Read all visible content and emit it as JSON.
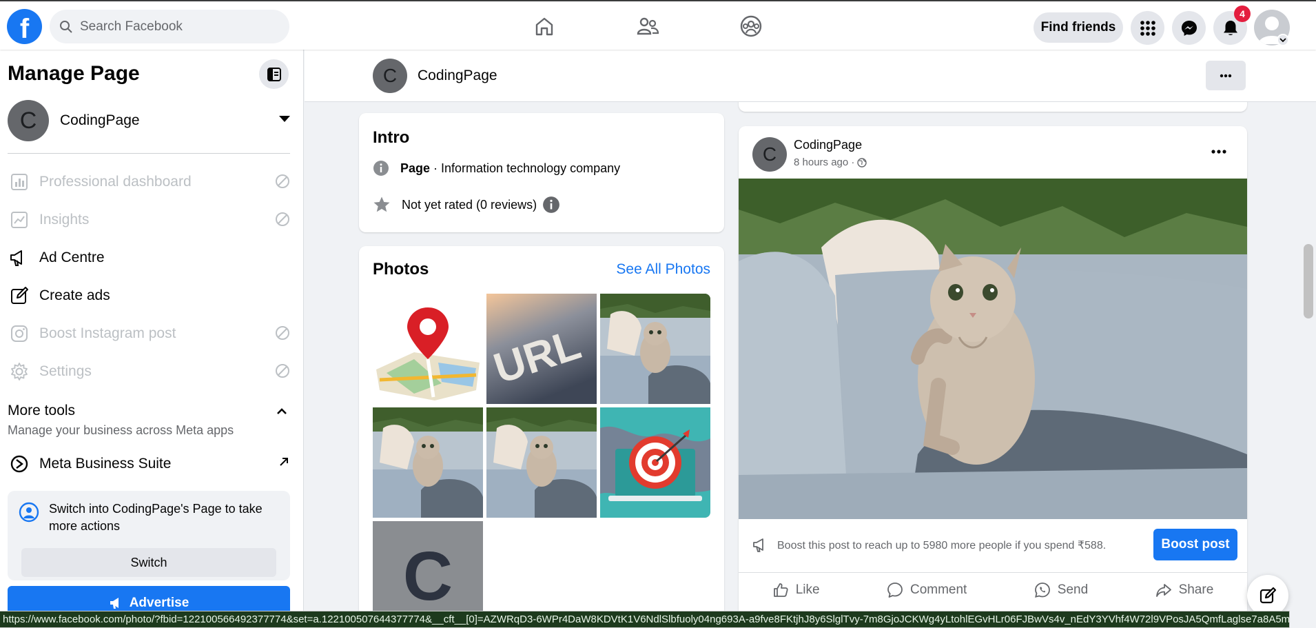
{
  "topbar": {
    "search_placeholder": "Search Facebook",
    "find_friends": "Find friends",
    "notification_count": "4",
    "logo_letter": "f"
  },
  "sidebar": {
    "title": "Manage Page",
    "page_name": "CodingPage",
    "page_initial": "C",
    "items": [
      {
        "label": "Professional dashboard",
        "icon": "dashboard-icon",
        "disabled": true
      },
      {
        "label": "Insights",
        "icon": "insights-icon",
        "disabled": true
      },
      {
        "label": "Ad Centre",
        "icon": "megaphone-icon",
        "disabled": false
      },
      {
        "label": "Create ads",
        "icon": "pencil-icon",
        "disabled": false
      },
      {
        "label": "Boost Instagram post",
        "icon": "instagram-icon",
        "disabled": true
      },
      {
        "label": "Settings",
        "icon": "gear-icon",
        "disabled": true
      }
    ],
    "more_tools": {
      "heading": "More tools",
      "subtitle": "Manage your business across Meta apps",
      "meta_business_suite": "Meta Business Suite"
    },
    "switch_box": {
      "text": "Switch into CodingPage's Page to take more actions",
      "button": "Switch"
    },
    "advertise": "Advertise"
  },
  "page_header": {
    "name": "CodingPage",
    "initial": "C"
  },
  "intro": {
    "heading": "Intro",
    "category_label": "Page",
    "category_value": " · Information technology company",
    "rating": "Not yet rated (0 reviews)"
  },
  "photos": {
    "heading": "Photos",
    "see_all": "See All Photos",
    "tiles": [
      "map-pin",
      "url-sign",
      "kitten",
      "kitten",
      "kitten",
      "target-laptop",
      "letter-c"
    ],
    "letter_tile": "C"
  },
  "post": {
    "author": "CodingPage",
    "initial": "C",
    "time": "8 hours ago ·",
    "boost_text": "Boost this post to reach up to 5980 more people if you spend ₹588.",
    "boost_button": "Boost post",
    "actions": {
      "like": "Like",
      "comment": "Comment",
      "send": "Send",
      "share": "Share"
    }
  },
  "statusbar": {
    "url": "https://www.facebook.com/photo/?fbid=122100566492377774&set=a.122100507644377774&__cft__[0]=AZWRqD3-6WPr4DaW8KDVtK1V6NdlSlbfuoly04ng693A-a9fve8FKtjhJ8y6SlglTvy-7m8GjoJCKWg4yLtohlEGvHLr06FJBwVs4v_nEdY3YVhf4W72l9VPosJA5QmfLaglse7a8A5m68Ell..."
  },
  "colors": {
    "brand": "#1877f2",
    "badge": "#e41e3f",
    "background": "#f0f2f5"
  }
}
